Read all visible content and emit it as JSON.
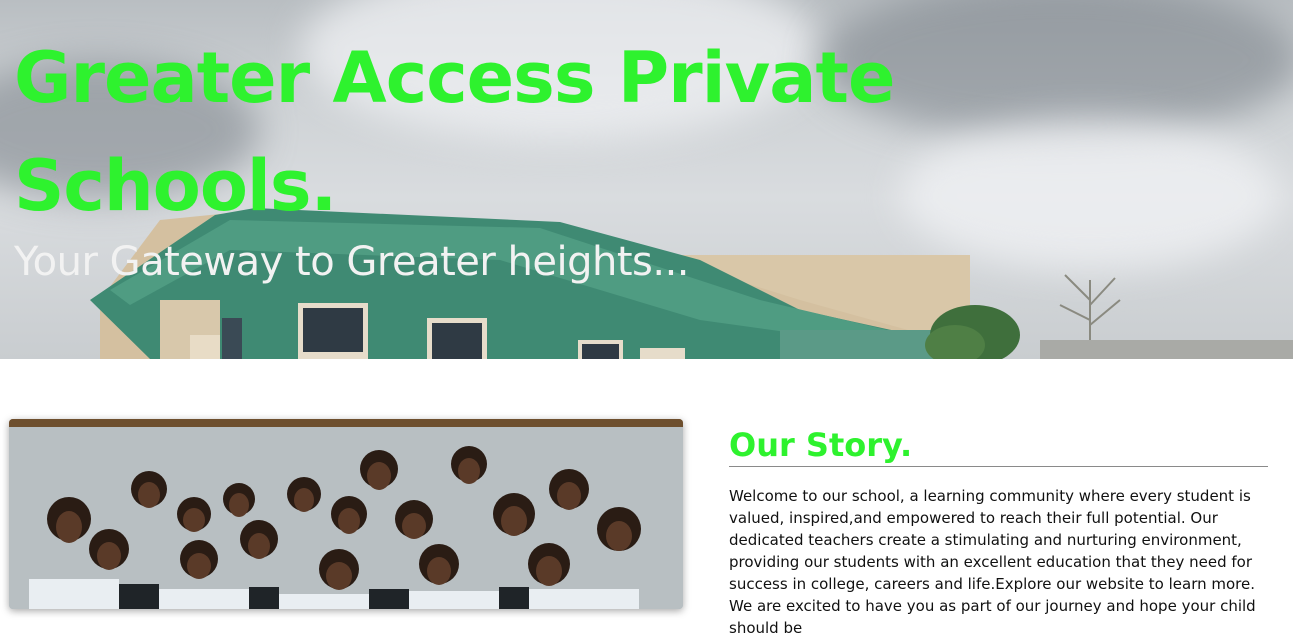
{
  "hero": {
    "title": "Greater Access Private Schools.",
    "subtitle": "Your Gateway to Greater heights...",
    "title_color": "#2ef22e",
    "subtitle_color": "#f2f2f2",
    "background_image": "school-building-photo"
  },
  "gallery": {
    "image": "students-group-photo"
  },
  "story": {
    "heading": "Our Story.",
    "body": "Welcome to our school, a learning community where every student is valued, inspired,and empowered to reach their full potential. Our dedicated teachers create a stimulating and nurturing environment, providing our students with an excellent education that they need for success in college, careers and life.Explore our website to learn more. We are excited to have you as part of our journey and hope your child should be",
    "heading_color": "#2ef22e"
  }
}
